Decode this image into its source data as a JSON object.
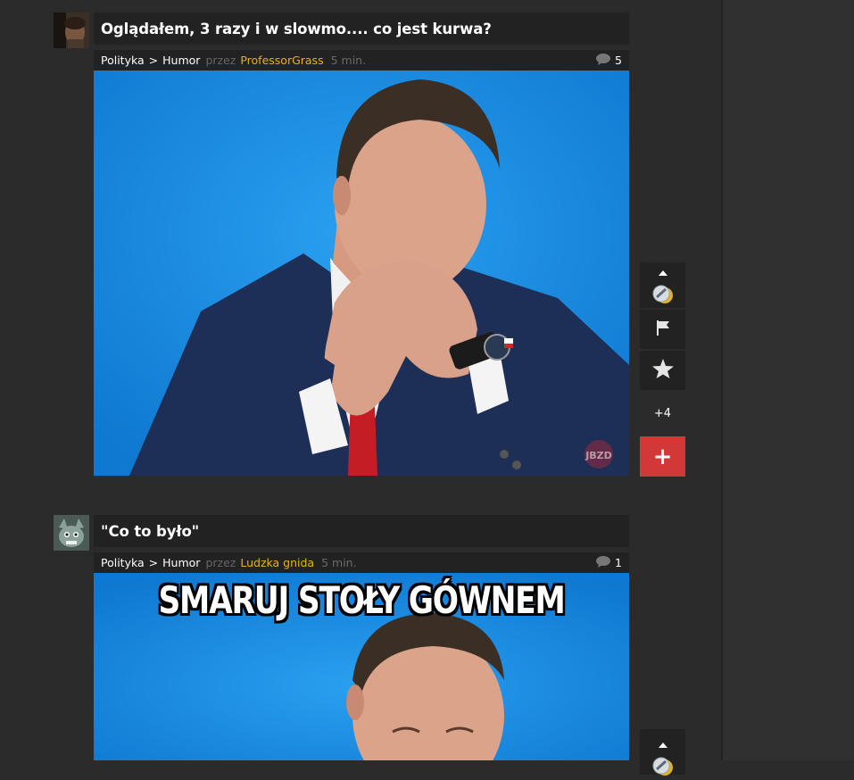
{
  "posts": [
    {
      "title": "Oglądałem, 3 razy i w slowmo.... co jest kurwa?",
      "category": "Polityka",
      "subcategory": "Humor",
      "by_label": "przez",
      "author": "ProfessorGrass",
      "time": "5 min.",
      "comments": "5",
      "score": "+4",
      "plus_label": "+",
      "watermark": "JBZD"
    },
    {
      "title": "\"Co to było\"",
      "category": "Polityka",
      "subcategory": "Humor",
      "by_label": "przez",
      "author": "Ludzka gnida",
      "time": "5 min.",
      "comments": "1",
      "caption": "SMARUJ STOŁY GÓWNEM"
    }
  ],
  "separator": ">",
  "icons": {
    "comment": "comment-bubble-icon",
    "vote_up": "chevron-up-icon",
    "medal": "medal-icon",
    "flag": "flag-icon",
    "favorite": "star-icon"
  },
  "colors": {
    "background": "#2b2b2b",
    "bar": "#222222",
    "author": "#e8b500",
    "plus": "#d23838",
    "image_bg": "#1e8fe3"
  }
}
